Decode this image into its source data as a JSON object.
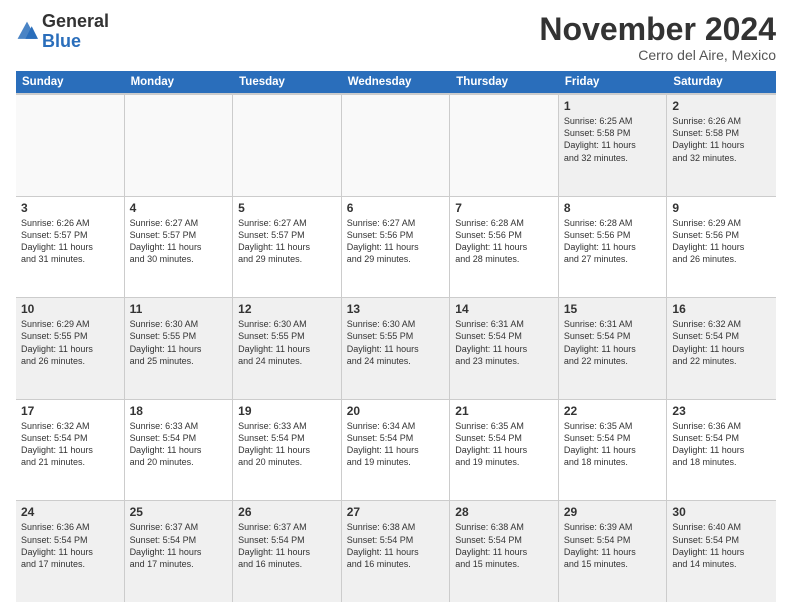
{
  "header": {
    "logo_general": "General",
    "logo_blue": "Blue",
    "month_title": "November 2024",
    "location": "Cerro del Aire, Mexico"
  },
  "calendar": {
    "days_of_week": [
      "Sunday",
      "Monday",
      "Tuesday",
      "Wednesday",
      "Thursday",
      "Friday",
      "Saturday"
    ],
    "rows": [
      [
        {
          "day": "",
          "empty": true
        },
        {
          "day": "",
          "empty": true
        },
        {
          "day": "",
          "empty": true
        },
        {
          "day": "",
          "empty": true
        },
        {
          "day": "",
          "empty": true
        },
        {
          "day": "1",
          "lines": [
            "Sunrise: 6:25 AM",
            "Sunset: 5:58 PM",
            "Daylight: 11 hours",
            "and 32 minutes."
          ]
        },
        {
          "day": "2",
          "lines": [
            "Sunrise: 6:26 AM",
            "Sunset: 5:58 PM",
            "Daylight: 11 hours",
            "and 32 minutes."
          ]
        }
      ],
      [
        {
          "day": "3",
          "lines": [
            "Sunrise: 6:26 AM",
            "Sunset: 5:57 PM",
            "Daylight: 11 hours",
            "and 31 minutes."
          ]
        },
        {
          "day": "4",
          "lines": [
            "Sunrise: 6:27 AM",
            "Sunset: 5:57 PM",
            "Daylight: 11 hours",
            "and 30 minutes."
          ]
        },
        {
          "day": "5",
          "lines": [
            "Sunrise: 6:27 AM",
            "Sunset: 5:57 PM",
            "Daylight: 11 hours",
            "and 29 minutes."
          ]
        },
        {
          "day": "6",
          "lines": [
            "Sunrise: 6:27 AM",
            "Sunset: 5:56 PM",
            "Daylight: 11 hours",
            "and 29 minutes."
          ]
        },
        {
          "day": "7",
          "lines": [
            "Sunrise: 6:28 AM",
            "Sunset: 5:56 PM",
            "Daylight: 11 hours",
            "and 28 minutes."
          ]
        },
        {
          "day": "8",
          "lines": [
            "Sunrise: 6:28 AM",
            "Sunset: 5:56 PM",
            "Daylight: 11 hours",
            "and 27 minutes."
          ]
        },
        {
          "day": "9",
          "lines": [
            "Sunrise: 6:29 AM",
            "Sunset: 5:56 PM",
            "Daylight: 11 hours",
            "and 26 minutes."
          ]
        }
      ],
      [
        {
          "day": "10",
          "lines": [
            "Sunrise: 6:29 AM",
            "Sunset: 5:55 PM",
            "Daylight: 11 hours",
            "and 26 minutes."
          ]
        },
        {
          "day": "11",
          "lines": [
            "Sunrise: 6:30 AM",
            "Sunset: 5:55 PM",
            "Daylight: 11 hours",
            "and 25 minutes."
          ]
        },
        {
          "day": "12",
          "lines": [
            "Sunrise: 6:30 AM",
            "Sunset: 5:55 PM",
            "Daylight: 11 hours",
            "and 24 minutes."
          ]
        },
        {
          "day": "13",
          "lines": [
            "Sunrise: 6:30 AM",
            "Sunset: 5:55 PM",
            "Daylight: 11 hours",
            "and 24 minutes."
          ]
        },
        {
          "day": "14",
          "lines": [
            "Sunrise: 6:31 AM",
            "Sunset: 5:54 PM",
            "Daylight: 11 hours",
            "and 23 minutes."
          ]
        },
        {
          "day": "15",
          "lines": [
            "Sunrise: 6:31 AM",
            "Sunset: 5:54 PM",
            "Daylight: 11 hours",
            "and 22 minutes."
          ]
        },
        {
          "day": "16",
          "lines": [
            "Sunrise: 6:32 AM",
            "Sunset: 5:54 PM",
            "Daylight: 11 hours",
            "and 22 minutes."
          ]
        }
      ],
      [
        {
          "day": "17",
          "lines": [
            "Sunrise: 6:32 AM",
            "Sunset: 5:54 PM",
            "Daylight: 11 hours",
            "and 21 minutes."
          ]
        },
        {
          "day": "18",
          "lines": [
            "Sunrise: 6:33 AM",
            "Sunset: 5:54 PM",
            "Daylight: 11 hours",
            "and 20 minutes."
          ]
        },
        {
          "day": "19",
          "lines": [
            "Sunrise: 6:33 AM",
            "Sunset: 5:54 PM",
            "Daylight: 11 hours",
            "and 20 minutes."
          ]
        },
        {
          "day": "20",
          "lines": [
            "Sunrise: 6:34 AM",
            "Sunset: 5:54 PM",
            "Daylight: 11 hours",
            "and 19 minutes."
          ]
        },
        {
          "day": "21",
          "lines": [
            "Sunrise: 6:35 AM",
            "Sunset: 5:54 PM",
            "Daylight: 11 hours",
            "and 19 minutes."
          ]
        },
        {
          "day": "22",
          "lines": [
            "Sunrise: 6:35 AM",
            "Sunset: 5:54 PM",
            "Daylight: 11 hours",
            "and 18 minutes."
          ]
        },
        {
          "day": "23",
          "lines": [
            "Sunrise: 6:36 AM",
            "Sunset: 5:54 PM",
            "Daylight: 11 hours",
            "and 18 minutes."
          ]
        }
      ],
      [
        {
          "day": "24",
          "lines": [
            "Sunrise: 6:36 AM",
            "Sunset: 5:54 PM",
            "Daylight: 11 hours",
            "and 17 minutes."
          ]
        },
        {
          "day": "25",
          "lines": [
            "Sunrise: 6:37 AM",
            "Sunset: 5:54 PM",
            "Daylight: 11 hours",
            "and 17 minutes."
          ]
        },
        {
          "day": "26",
          "lines": [
            "Sunrise: 6:37 AM",
            "Sunset: 5:54 PM",
            "Daylight: 11 hours",
            "and 16 minutes."
          ]
        },
        {
          "day": "27",
          "lines": [
            "Sunrise: 6:38 AM",
            "Sunset: 5:54 PM",
            "Daylight: 11 hours",
            "and 16 minutes."
          ]
        },
        {
          "day": "28",
          "lines": [
            "Sunrise: 6:38 AM",
            "Sunset: 5:54 PM",
            "Daylight: 11 hours",
            "and 15 minutes."
          ]
        },
        {
          "day": "29",
          "lines": [
            "Sunrise: 6:39 AM",
            "Sunset: 5:54 PM",
            "Daylight: 11 hours",
            "and 15 minutes."
          ]
        },
        {
          "day": "30",
          "lines": [
            "Sunrise: 6:40 AM",
            "Sunset: 5:54 PM",
            "Daylight: 11 hours",
            "and 14 minutes."
          ]
        }
      ]
    ]
  }
}
